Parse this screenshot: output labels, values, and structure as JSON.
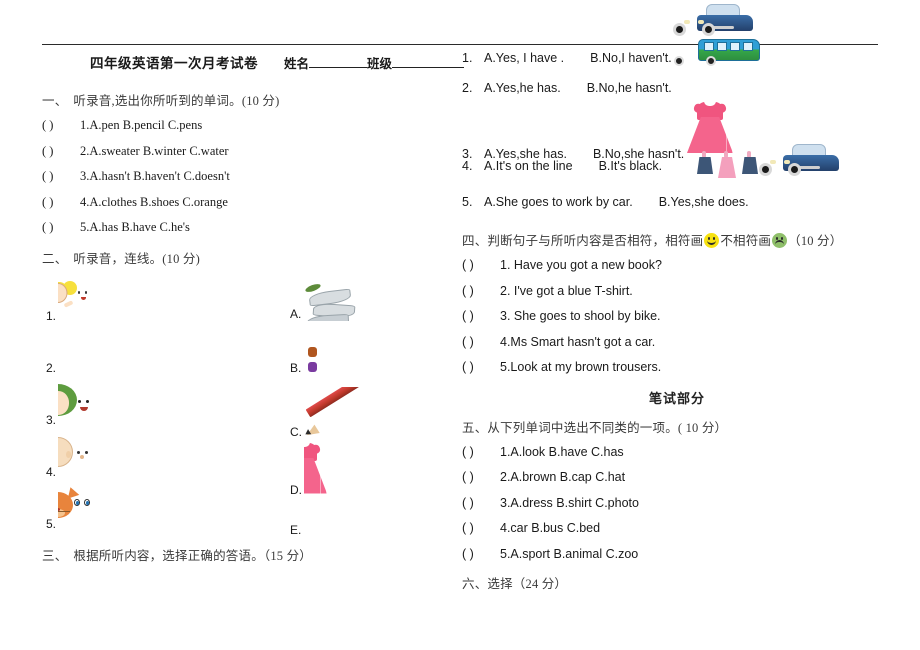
{
  "header": {
    "title": "四年级英语第一次月考试卷",
    "name_label": "姓名",
    "class_label": "班级"
  },
  "sections": {
    "s1": {
      "num": "一、",
      "heading": "听录音,选出你所听到的单词。(10 分)",
      "questions": [
        {
          "paren": "(        )",
          "text": "1.A.pen      B.pencil   C.pens"
        },
        {
          "paren": "(        )",
          "text": "2.A.sweater   B.winter   C.water"
        },
        {
          "paren": "(        )",
          "text": "3.A.hasn't       B.haven't      C.doesn't"
        },
        {
          "paren": "(        )",
          "text": "4.A.clothes       B.shoes      C.orange"
        },
        {
          "paren": "(        )",
          "text": "5.A.has     B.have     C.he's"
        }
      ]
    },
    "s2": {
      "num": "二、",
      "heading": "听录音，连线。(10 分)",
      "left_items": [
        {
          "label": "1.",
          "icon": "girl-pigtails-image"
        },
        {
          "label": "2.",
          "icon": "man-with-tie-image"
        },
        {
          "label": "3.",
          "icon": "green-haired-woman-image"
        },
        {
          "label": "4.",
          "icon": "bald-man-image"
        },
        {
          "label": "5.",
          "icon": "orange-cat-image"
        }
      ],
      "right_items": [
        {
          "label": "A.",
          "icon": "fish-image"
        },
        {
          "label": "B.",
          "icon": "picture-book-image"
        },
        {
          "label": "C.",
          "icon": "pencil-image"
        },
        {
          "label": "D.",
          "icon": "pink-dress-image"
        },
        {
          "label": "E.",
          "icon": "blue-car-image"
        }
      ]
    },
    "s3": {
      "num": "三、",
      "heading": "根据所听内容，选择正确的答语。（15 分）",
      "answers": [
        {
          "num": "1.",
          "a": "A.Yes, I have .",
          "b": "B.No,I haven't.",
          "deco": "blue-car-image"
        },
        {
          "num": "2.",
          "a": "A.Yes,he has.",
          "b": "B.No,he hasn't.",
          "deco": "bus-image"
        },
        {
          "num": "3.",
          "a": "A.Yes,she has.",
          "b": "B.No,she hasn't.",
          "deco": "pink-dress-image"
        },
        {
          "num": "4.",
          "a": "A.It's on the line",
          "b": "B.It's black.",
          "deco": "clothesline-image"
        },
        {
          "num": "5.",
          "a": "A.She goes to work by car.",
          "b": "B.Yes,she does.",
          "deco": "blue-car-image"
        }
      ]
    },
    "s4": {
      "num": "四、",
      "heading_part1": "判断句子与所听内容是否相符，相符画",
      "heading_part2": "不相符画",
      "heading_part3": "（10 分）",
      "questions": [
        {
          "paren": "(        )",
          "text": "1.  Have you got a new book?"
        },
        {
          "paren": "(        )",
          "text": "2.   I've got a blue T-shirt."
        },
        {
          "paren": "(        )",
          "text": "3.  She goes to shool by bike."
        },
        {
          "paren": "(        )",
          "text": "4.Ms Smart hasn't got a car."
        },
        {
          "paren": "(        )",
          "text": "5.Look at my brown trousers."
        }
      ]
    },
    "written_part": "笔试部分",
    "s5": {
      "num": "五、",
      "heading": "从下列单词中选出不同类的一项。( 10 分）",
      "questions": [
        {
          "paren": "(       )",
          "text": "1.A.look   B.have     C.has"
        },
        {
          "paren": "(       )",
          "text": "2.A.brown   B.cap   C.hat"
        },
        {
          "paren": "(       )",
          "text": "3.A.dress   B.shirt   C.photo"
        },
        {
          "paren": "(       )",
          "text": "4.car     B.bus      C.bed"
        },
        {
          "paren": "(       )",
          "text": "5.A.sport   B.animal   C.zoo"
        }
      ]
    },
    "s6": {
      "num": "六、",
      "heading": "选择（24 分）"
    }
  }
}
